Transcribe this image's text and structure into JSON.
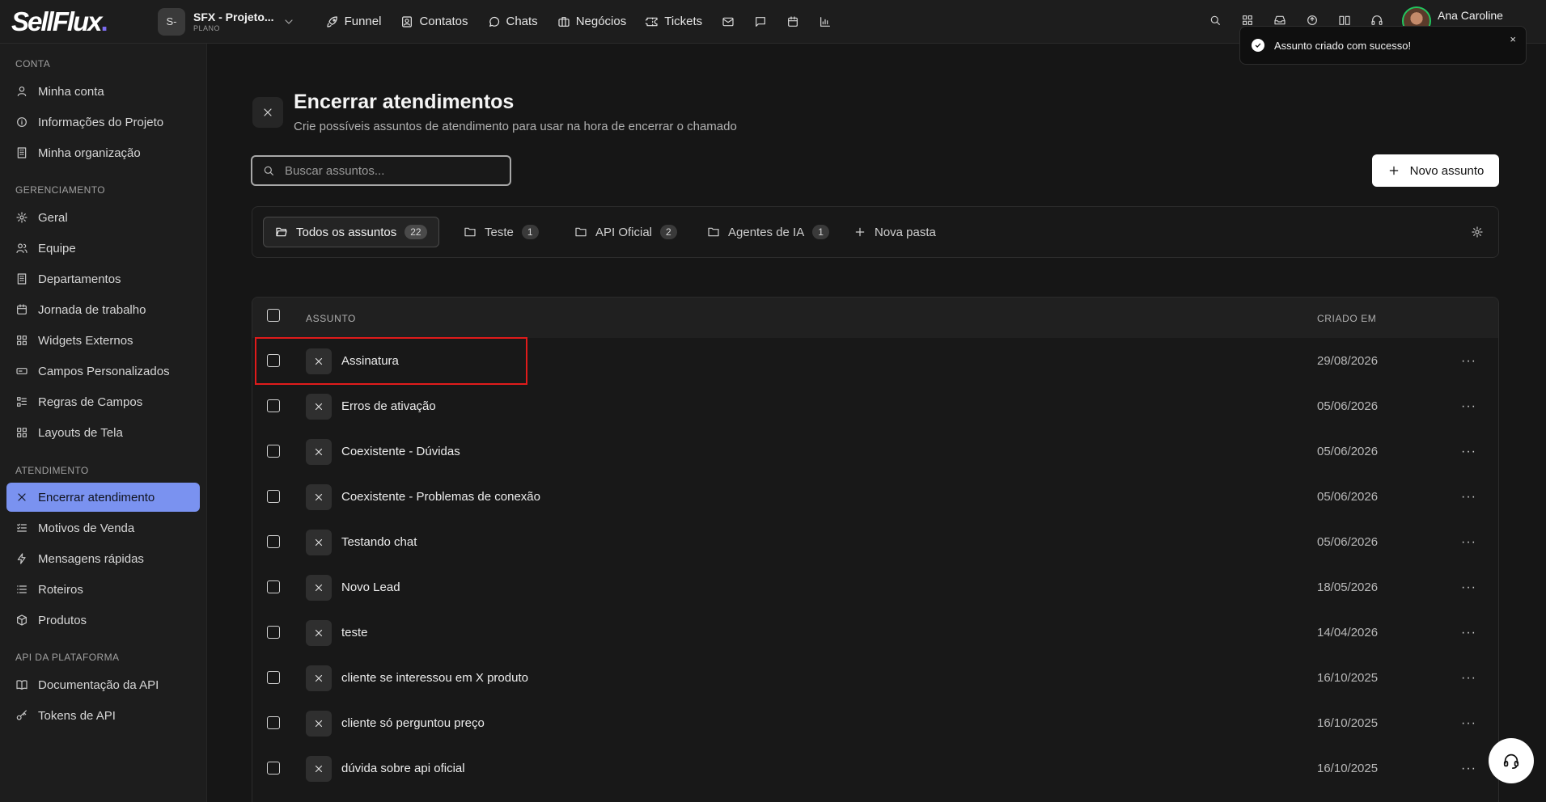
{
  "app": {
    "logo": "SellFlux",
    "logo_dot": "."
  },
  "project": {
    "initial": "S-",
    "name": "SFX - Projeto...",
    "plan": "PLANO"
  },
  "nav": [
    {
      "label": "Funnel",
      "icon": "rocket-icon"
    },
    {
      "label": "Contatos",
      "icon": "contacts-icon"
    },
    {
      "label": "Chats",
      "icon": "chat-bubble-icon"
    },
    {
      "label": "Negócios",
      "icon": "briefcase-icon"
    },
    {
      "label": "Tickets",
      "icon": "ticket-icon"
    }
  ],
  "user": {
    "name": "Ana Caroline"
  },
  "toast": {
    "message": "Assunto criado com sucesso!",
    "close": "×"
  },
  "sidebar": {
    "sections": [
      {
        "title": "CONTA",
        "items": [
          "Minha conta",
          "Informações do Projeto",
          "Minha organização"
        ]
      },
      {
        "title": "GERENCIAMENTO",
        "items": [
          "Geral",
          "Equipe",
          "Departamentos",
          "Jornada de trabalho",
          "Widgets Externos",
          "Campos Personalizados",
          "Regras de Campos",
          "Layouts de Tela"
        ]
      },
      {
        "title": "ATENDIMENTO",
        "items": [
          "Encerrar atendimento",
          "Motivos de Venda",
          "Mensagens rápidas",
          "Roteiros",
          "Produtos"
        ]
      },
      {
        "title": "API DA PLATAFORMA",
        "items": [
          "Documentação da API",
          "Tokens de API"
        ]
      }
    ],
    "active": "Encerrar atendimento"
  },
  "page": {
    "title": "Encerrar atendimentos",
    "subtitle": "Crie possíveis assuntos de atendimento para usar na hora de encerrar o chamado",
    "search_placeholder": "Buscar assuntos...",
    "new_button": "Novo assunto"
  },
  "folders": [
    {
      "label": "Todos os assuntos",
      "count": "22",
      "active": true
    },
    {
      "label": "Teste",
      "count": "1"
    },
    {
      "label": "API Oficial",
      "count": "2"
    },
    {
      "label": "Agentes de IA",
      "count": "1"
    }
  ],
  "new_folder": "Nova pasta",
  "table": {
    "columns": {
      "subject": "ASSUNTO",
      "created": "CRIADO EM"
    },
    "more": "···",
    "rows": [
      {
        "name": "Assinatura",
        "date": "29/08/2026"
      },
      {
        "name": "Erros de ativação",
        "date": "05/06/2026"
      },
      {
        "name": "Coexistente - Dúvidas",
        "date": "05/06/2026"
      },
      {
        "name": "Coexistente - Problemas de conexão",
        "date": "05/06/2026"
      },
      {
        "name": "Testando chat",
        "date": "05/06/2026"
      },
      {
        "name": "Novo Lead",
        "date": "18/05/2026"
      },
      {
        "name": "teste",
        "date": "14/04/2026"
      },
      {
        "name": "cliente se interessou em X produto",
        "date": "16/10/2025"
      },
      {
        "name": "cliente só perguntou preço",
        "date": "16/10/2025"
      },
      {
        "name": "dúvida sobre api oficial",
        "date": "16/10/2025"
      }
    ]
  },
  "colors": {
    "accent": "#7a92f0",
    "highlight": "#e01b1b",
    "success": "#22c55e"
  }
}
